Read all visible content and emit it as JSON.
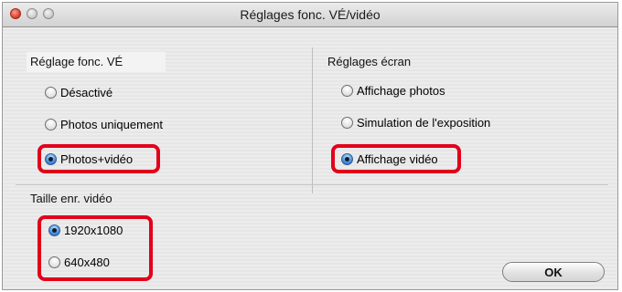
{
  "window": {
    "title": "Réglages fonc. VÉ/vidéo"
  },
  "left_group": {
    "label": "Réglage fonc. VÉ",
    "options": [
      {
        "label": "Désactivé",
        "selected": false
      },
      {
        "label": "Photos uniquement",
        "selected": false
      },
      {
        "label": "Photos+vidéo",
        "selected": true
      }
    ]
  },
  "right_group": {
    "label": "Réglages écran",
    "options": [
      {
        "label": "Affichage photos",
        "selected": false
      },
      {
        "label": "Simulation de l'exposition",
        "selected": false
      },
      {
        "label": "Affichage vidéo",
        "selected": true
      }
    ]
  },
  "video_size": {
    "label": "Taille enr. vidéo",
    "options": [
      {
        "label": "1920x1080",
        "selected": true
      },
      {
        "label": "640x480",
        "selected": false
      }
    ]
  },
  "ok_button": {
    "label": "OK"
  },
  "colors": {
    "highlight": "#e3001b",
    "radio_selected": "#3a7fd0"
  }
}
